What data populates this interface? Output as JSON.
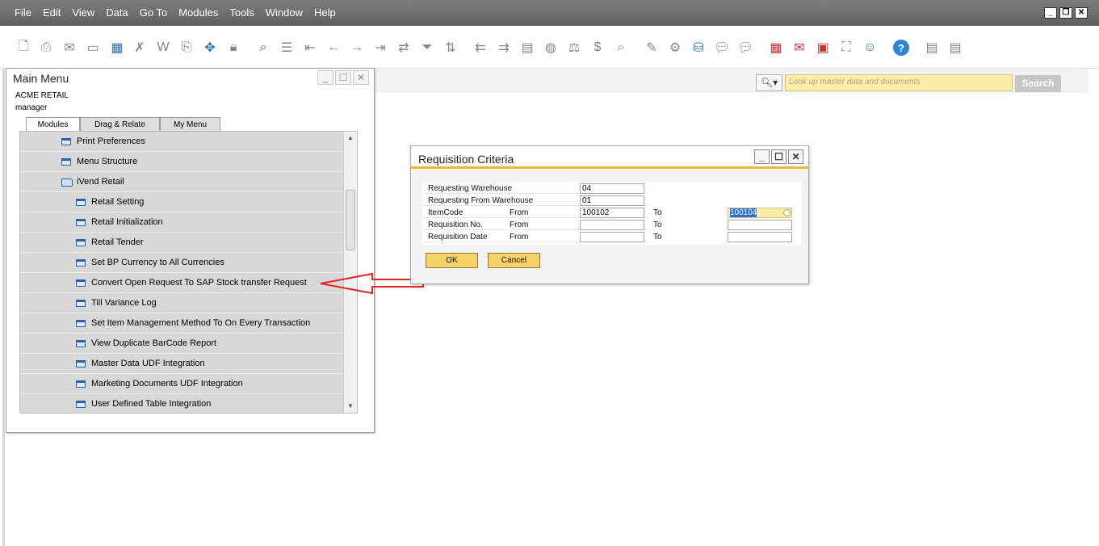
{
  "menubar": {
    "items": [
      "File",
      "Edit",
      "View",
      "Data",
      "Go To",
      "Modules",
      "Tools",
      "Window",
      "Help"
    ]
  },
  "toolbar": {
    "icons": [
      "preview-icon",
      "print-icon",
      "email-icon",
      "sms-icon",
      "fax-icon",
      "excel-icon",
      "word-icon",
      "pdf-icon",
      "launch-icon",
      "lock-icon",
      "find-icon",
      "add-icon",
      "first-record-icon",
      "previous-record-icon",
      "next-record-icon",
      "last-record-icon",
      "refresh-icon",
      "filter-icon",
      "sort-icon",
      "base-document-icon",
      "target-document-icon",
      "journal-entry-icon",
      "payment-means-icon",
      "gross-profit-icon",
      "settings-icon",
      "query-icon",
      "edit-icon",
      "form-settings-icon",
      "data-transfer-icon",
      "messages-icon",
      "alerts-icon",
      "calendar-icon",
      "email-inbox-icon",
      "activity-icon",
      "org-chart-icon",
      "user-icon",
      "help-icon",
      "calculator-icon",
      "document-settings-icon"
    ]
  },
  "main_menu": {
    "title": "Main Menu",
    "company": "ACME RETAIL",
    "user": "manager",
    "tabs": [
      "Modules",
      "Drag & Relate",
      "My Menu"
    ],
    "items": [
      {
        "label": "Print Preferences",
        "level": 1,
        "type": "form"
      },
      {
        "label": "Menu Structure",
        "level": 1,
        "type": "form"
      },
      {
        "label": "iVend Retail",
        "level": 1,
        "type": "folder"
      },
      {
        "label": "Retail Setting",
        "level": 2,
        "type": "form"
      },
      {
        "label": "Retail Initialization",
        "level": 2,
        "type": "form"
      },
      {
        "label": "Retail Tender",
        "level": 2,
        "type": "form"
      },
      {
        "label": "Set BP Currency to All Currencies",
        "level": 2,
        "type": "form"
      },
      {
        "label": "Convert Open Request To SAP Stock transfer Request",
        "level": 2,
        "type": "form"
      },
      {
        "label": "Till Variance Log",
        "level": 2,
        "type": "form"
      },
      {
        "label": "Set Item Management Method To On Every Transaction",
        "level": 2,
        "type": "form"
      },
      {
        "label": "View Duplicate BarCode Report",
        "level": 2,
        "type": "form"
      },
      {
        "label": "Master Data UDF Integration",
        "level": 2,
        "type": "form"
      },
      {
        "label": "Marketing Documents UDF Integration",
        "level": 2,
        "type": "form"
      },
      {
        "label": "User Defined Table Integration",
        "level": 2,
        "type": "form"
      }
    ]
  },
  "search": {
    "placeholder": "Look up master data and documents",
    "button": "Search"
  },
  "dialog": {
    "title": "Requisition Criteria",
    "fields": {
      "requesting_warehouse": {
        "label": "Requesting Warehouse",
        "value": "04"
      },
      "requesting_from_warehouse": {
        "label": "Requesting From Warehouse",
        "value": "01"
      },
      "item_code": {
        "label": "ItemCode",
        "from_label": "From",
        "from": "100102",
        "to_label": "To",
        "to": "100104"
      },
      "requisition_no": {
        "label": "Requisition No.",
        "from_label": "From",
        "from": "",
        "to_label": "To",
        "to": ""
      },
      "requisition_date": {
        "label": "Requisition Date",
        "from_label": "From",
        "from": "",
        "to_label": "To",
        "to": ""
      }
    },
    "ok_button": "OK",
    "cancel_button": "Cancel"
  },
  "colors": {
    "accent": "#f1b634",
    "highlight_field": "#fbeea8",
    "annotation_arrow": "#e0262a"
  }
}
